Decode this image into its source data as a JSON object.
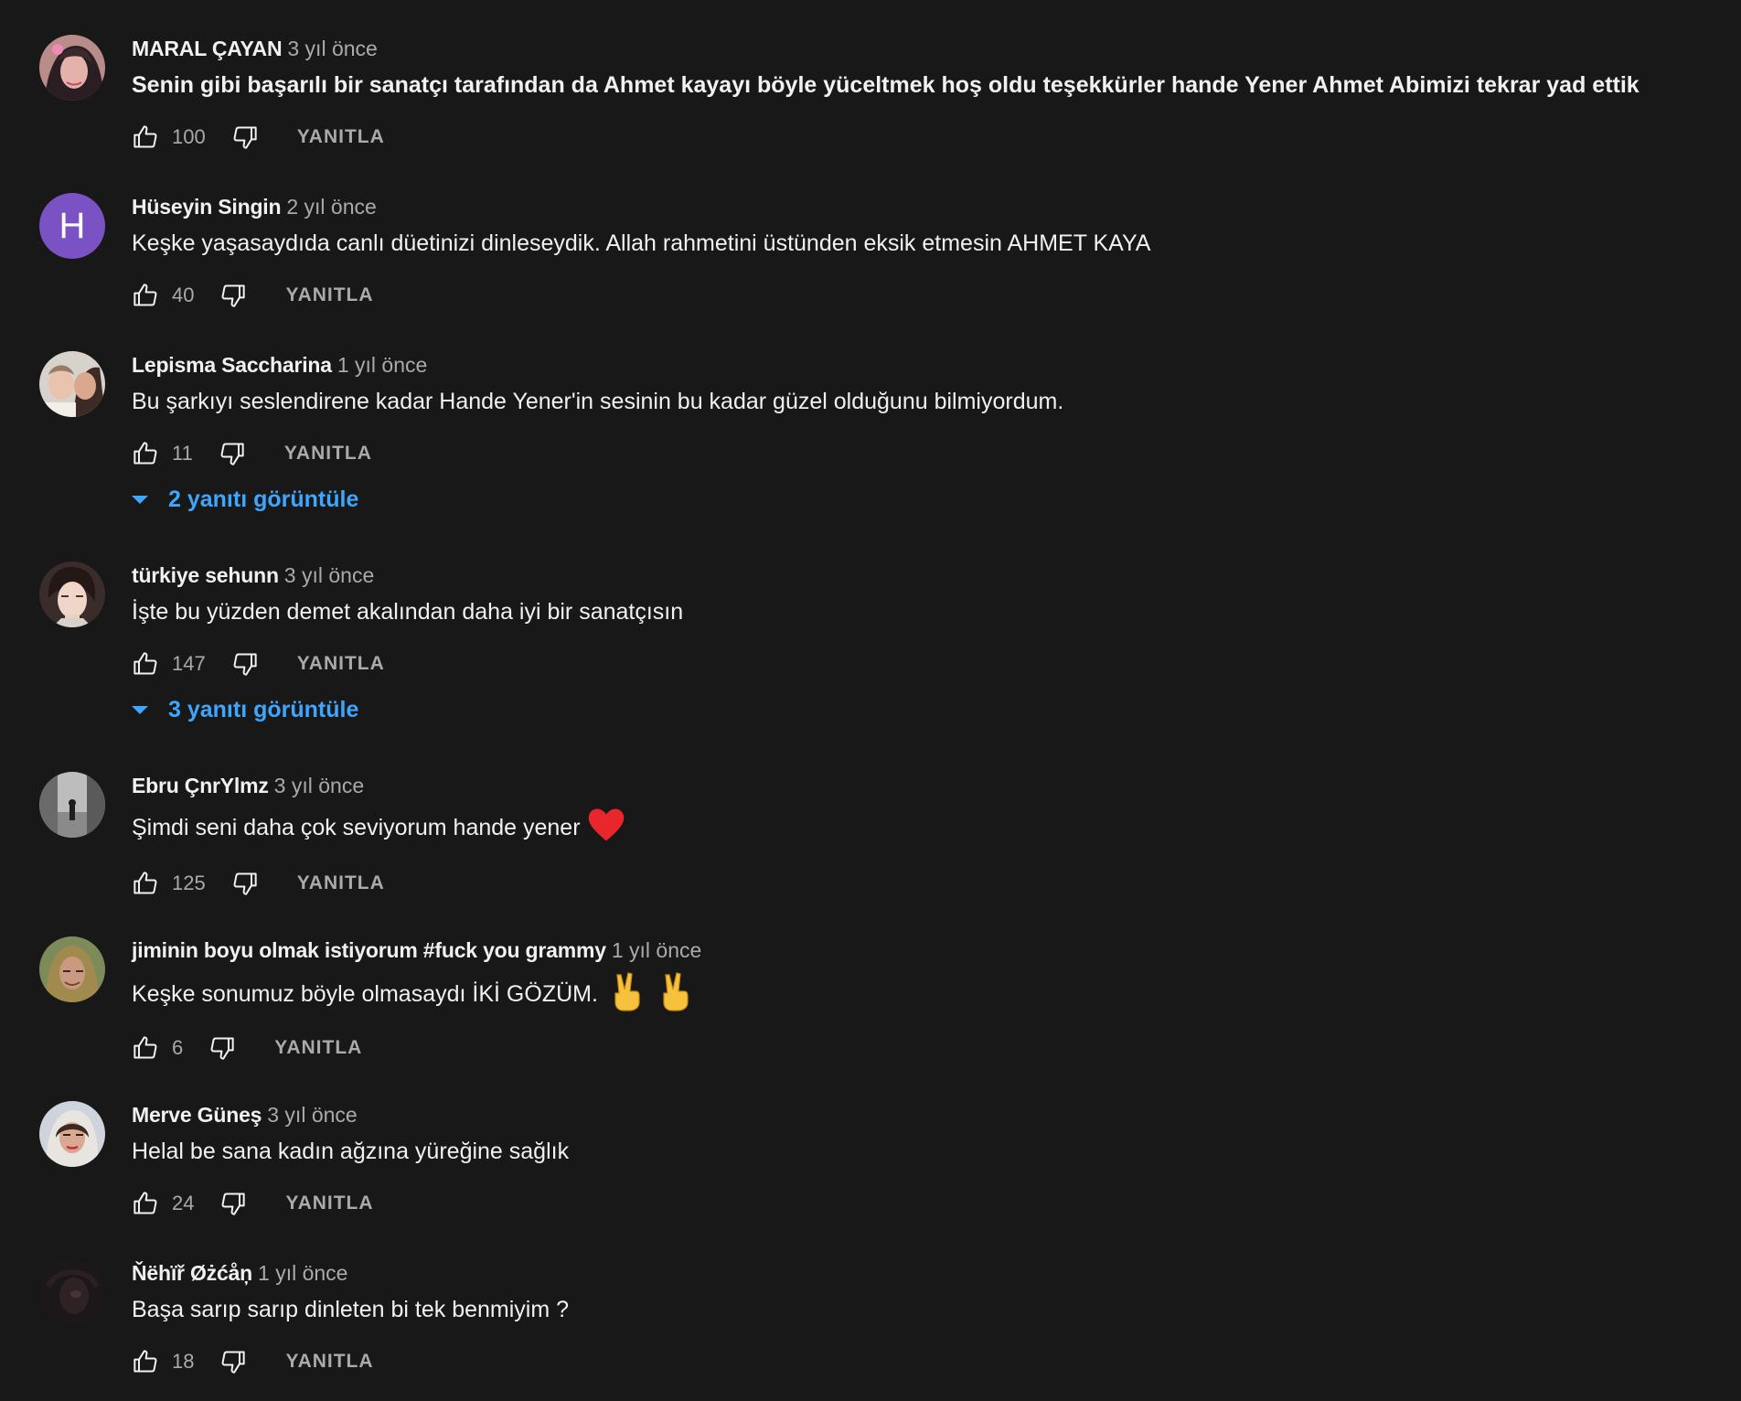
{
  "comments": [
    {
      "author": "MARAL ÇAYAN",
      "time": "3 yıl önce",
      "text": "Senin gibi başarılı bir sanatçı tarafından da Ahmet kayayı böyle yüceltmek hoş oldu teşekkürler hande Yener Ahmet Abimizi tekrar yad ettik",
      "likes": "100",
      "reply_label": "YANITLA",
      "avatar_icon": "profile-photo"
    },
    {
      "author": "Hüseyin Singin",
      "time": "2 yıl önce",
      "text": "Keşke yaşasaydıda canlı düetinizi dinleseydik. Allah rahmetini üstünden eksik etmesin AHMET KAYA",
      "likes": "40",
      "reply_label": "YANITLA",
      "avatar_letter": "H",
      "avatar_color": "#7b52c4"
    },
    {
      "author": "Lepisma Saccharina",
      "time": "1 yıl önce",
      "text": "Bu şarkıyı seslendirene kadar Hande Yener'in sesinin bu kadar güzel olduğunu bilmiyordum.",
      "likes": "11",
      "reply_label": "YANITLA",
      "view_replies": "2 yanıtı görüntüle"
    },
    {
      "author": "türkiye sehunn",
      "time": "3 yıl önce",
      "text": "İşte bu yüzden demet akalından daha iyi bir sanatçısın",
      "likes": "147",
      "reply_label": "YANITLA",
      "view_replies": "3 yanıtı görüntüle"
    },
    {
      "author": "Ebru ÇnrYlmz",
      "time": "3 yıl önce",
      "text": "Şimdi seni daha çok seviyorum hande yener",
      "emoji": "heart-emoji",
      "likes": "125",
      "reply_label": "YANITLA"
    },
    {
      "author": "jiminin boyu olmak istiyorum #fuck you grammy",
      "time": "1 yıl önce",
      "text": "Keşke sonumuz böyle olmasaydı İKİ GÖZÜM.",
      "emoji": "victory-hand-emoji",
      "likes": "6",
      "reply_label": "YANITLA"
    },
    {
      "author": "Merve Güneş",
      "time": "3 yıl önce",
      "text": "Helal be sana kadın ağzına yüreğine sağlık",
      "likes": "24",
      "reply_label": "YANITLA"
    },
    {
      "author": "Ňëhïř Øżćåņ",
      "time": "1 yıl önce",
      "text": "Başa sarıp sarıp dinleten bi tek benmiyim ?",
      "likes": "18",
      "reply_label": "YANITLA"
    }
  ],
  "colors": {
    "background": "#181818",
    "text": "#f1f1f1",
    "secondary": "#aaaaaa",
    "link": "#3ea6ff"
  }
}
